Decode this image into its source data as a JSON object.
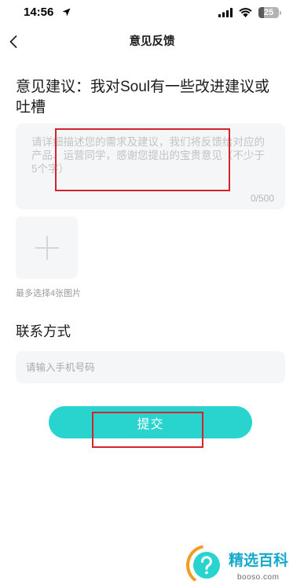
{
  "status_bar": {
    "time": "14:56",
    "battery_percent": 25
  },
  "nav": {
    "title": "意见反馈"
  },
  "feedback": {
    "heading": "意见建议：我对Soul有一些改进建议或吐槽",
    "placeholder": "请详细描述您的需求及建议，我们将反馈给对应的产品、运营同学，感谢您提出的宝贵意见（不少于5个字）",
    "char_counter": "0/500",
    "image_limit_hint": "最多选择4张图片"
  },
  "contact": {
    "heading": "联系方式",
    "phone_placeholder": "请输入手机号码"
  },
  "actions": {
    "submit_label": "提交"
  },
  "watermark": {
    "brand": "精选百科",
    "domain": "booso.com"
  },
  "icons": {
    "location": "location-arrow-icon",
    "signal": "cellular-signal-icon",
    "wifi": "wifi-icon",
    "battery": "battery-icon",
    "back": "chevron-left-icon",
    "add_image": "plus-icon",
    "watermark_badge": "question-mark-icon"
  },
  "colors": {
    "accent": "#29d4cf",
    "annotation_red": "#d1252b",
    "field_background": "#f5f6f8",
    "placeholder_text": "#c3c3c3",
    "watermark_brand": "#17a9cc",
    "watermark_swoosh": "#f59a23"
  }
}
